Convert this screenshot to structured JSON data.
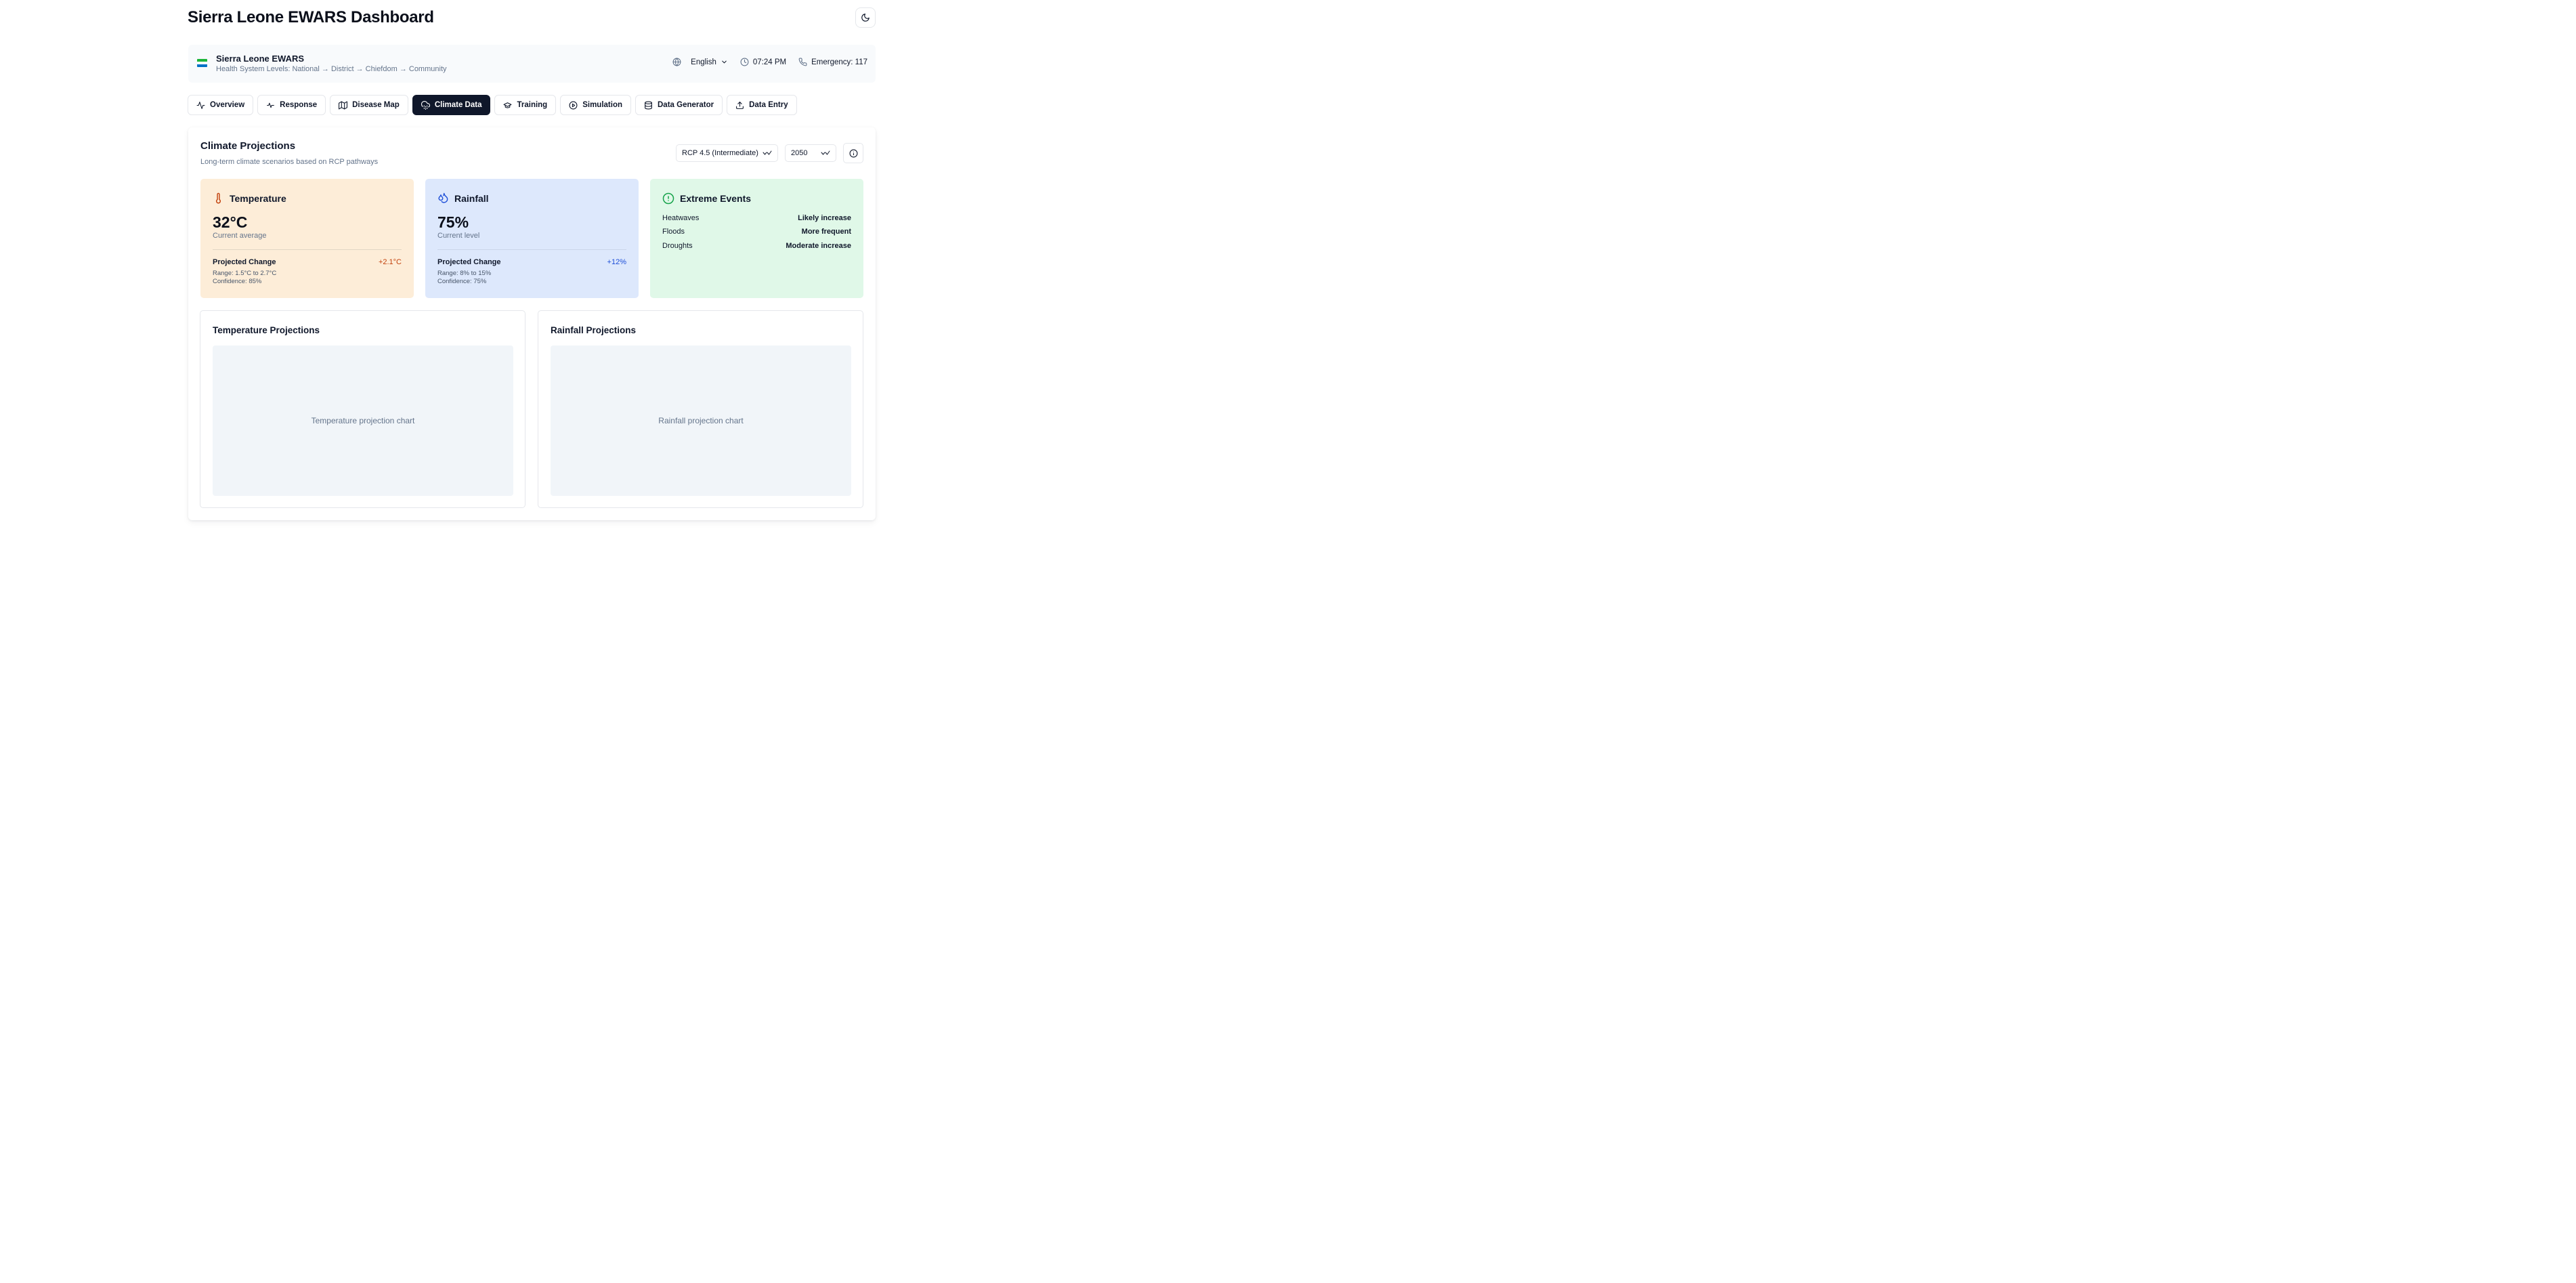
{
  "header": {
    "title": "Sierra Leone EWARS Dashboard",
    "theme_icon": "moon-icon"
  },
  "info_bar": {
    "flag_colors": [
      "#1eb53a",
      "#ffffff",
      "#0072c6"
    ],
    "name": "Sierra Leone EWARS",
    "levels": "Health System Levels: National → District → Chiefdom → Community",
    "language": "English",
    "time": "07:24 PM",
    "emergency": "Emergency: 117"
  },
  "tabs": [
    {
      "label": "Overview",
      "icon": "activity-icon"
    },
    {
      "label": "Response",
      "icon": "pulse-icon"
    },
    {
      "label": "Disease Map",
      "icon": "map-icon"
    },
    {
      "label": "Climate Data",
      "icon": "cloud-rain-icon",
      "active": true
    },
    {
      "label": "Training",
      "icon": "graduation-cap-icon"
    },
    {
      "label": "Simulation",
      "icon": "play-circle-icon"
    },
    {
      "label": "Data Generator",
      "icon": "database-icon"
    },
    {
      "label": "Data Entry",
      "icon": "upload-icon"
    }
  ],
  "climate": {
    "title": "Climate Projections",
    "subtitle": "Long-term climate scenarios based on RCP pathways",
    "scenario": "RCP 4.5 (Intermediate)",
    "year": "2050"
  },
  "temperature": {
    "title": "Temperature",
    "value": "32°C",
    "label": "Current average",
    "projected_label": "Projected Change",
    "delta": "+2.1°C",
    "range": "Range: 1.5°C to 2.7°C",
    "confidence": "Confidence: 85%",
    "accent": "#c2410c"
  },
  "rainfall": {
    "title": "Rainfall",
    "value": "75%",
    "label": "Current level",
    "projected_label": "Projected Change",
    "delta": "+12%",
    "range": "Range: 8% to 15%",
    "confidence": "Confidence: 75%",
    "accent": "#1d4ed8"
  },
  "extreme_events": {
    "title": "Extreme Events",
    "accent": "#16a34a",
    "items": [
      {
        "name": "Heatwaves",
        "value": "Likely increase"
      },
      {
        "name": "Floods",
        "value": "More frequent"
      },
      {
        "name": "Droughts",
        "value": "Moderate increase"
      }
    ]
  },
  "charts": {
    "temperature": {
      "title": "Temperature Projections",
      "placeholder": "Temperature projection chart"
    },
    "rainfall": {
      "title": "Rainfall Projections",
      "placeholder": "Rainfall projection chart"
    }
  }
}
